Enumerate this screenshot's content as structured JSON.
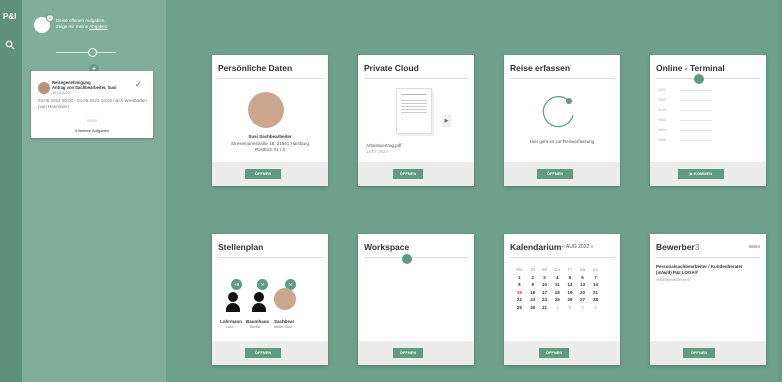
{
  "rail": {
    "logo": "P&I"
  },
  "sidebar": {
    "notif_line1": "Deine offenen Aufgaben.",
    "notif_line2": "Zeige mir meine",
    "notif_link": "Abgaben",
    "notif_count": "2",
    "task": {
      "title_line1": "Reisegenehmigung",
      "title_line2": "Antrag von Sachbearbeiter, Susi",
      "date": "09.10.2023",
      "desc": "03.05.2023 09:00 - 04.05.2023 18:00 nach Wiesbaden (von Hannover)",
      "sub": "00000",
      "more": "4 weitere Aufgaben"
    }
  },
  "cards": {
    "personal": {
      "title": "Persönliche Daten",
      "name": "Susi Sachbearbeiter",
      "addr": "Stresemannstraße 18, 21561 Hamburg",
      "phone": "Postfach 01 / 5",
      "btn": "ÖFFNEN"
    },
    "cloud": {
      "title": "Private Cloud",
      "file": "Arbeitsvertrag.pdf",
      "date": "11.07.2027",
      "btn": "ÖFFNEN"
    },
    "travel": {
      "title": "Reise erfassen",
      "hint": "Hier geht es zur Reiseerfassung",
      "btn": "ÖFFNEN"
    },
    "terminal": {
      "title": "Online - Terminal",
      "rows": [
        "0022",
        "0033",
        "11:40",
        "0033",
        "0044",
        "0055"
      ],
      "btn": "KOMMEN"
    },
    "org": {
      "title": "Stellenplan",
      "badge1": "+8",
      "names": [
        "Lohrmann",
        "Baumhaus",
        "Sachbear"
      ],
      "sub": [
        "Lutz",
        "Bertia",
        "beiter Susi"
      ],
      "btn": "ÖFFNEN"
    },
    "workspace": {
      "title": "Workspace",
      "btn": "ÖFFNEN"
    },
    "calendar": {
      "title": "Kalendarium",
      "month": "AUG 2022",
      "days": [
        "Mo",
        "Di",
        "Mi",
        "Do",
        "Fr",
        "Sa",
        "So"
      ],
      "weeks": [
        [
          "1",
          "2",
          "3",
          "4",
          "5",
          "6",
          "7"
        ],
        [
          "8",
          "9",
          "10",
          "11",
          "12",
          "13",
          "14"
        ],
        [
          "15",
          "16",
          "17",
          "18",
          "19",
          "20",
          "21"
        ],
        [
          "22",
          "23",
          "24",
          "25",
          "26",
          "27",
          "28"
        ],
        [
          "29",
          "30",
          "31",
          "1",
          "2",
          "3",
          "4"
        ]
      ],
      "btn": "ÖFFNEN"
    },
    "applicants": {
      "title": "Bewerber",
      "count": "3",
      "tag": "Intern",
      "job": "Personalsachbearbeiter / Kundenberater (m/w/d) P&I LOGA®",
      "subjob": "Hilfsmittelundefined",
      "btn": "ÖFFNEN"
    }
  }
}
